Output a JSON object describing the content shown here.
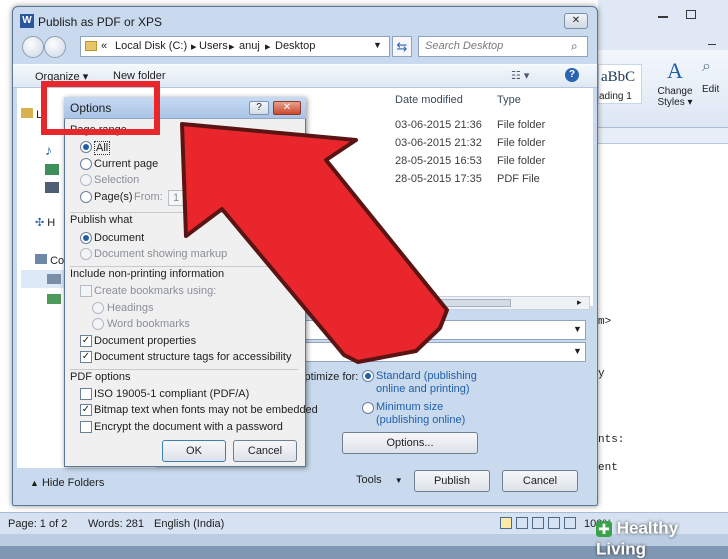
{
  "dialog": {
    "title": "Publish as PDF or XPS",
    "close_glyph": "✕",
    "address": {
      "prefix": "«",
      "parts": [
        "Local Disk (C:)",
        "Users",
        "anuj",
        "Desktop"
      ]
    },
    "search_placeholder": "Search Desktop",
    "toolbar": {
      "organize": "Organize ▾",
      "new_folder": "New folder"
    },
    "nav": [
      {
        "label": "Li",
        "icon": "library-icon"
      },
      {
        "label": "H",
        "icon": "homegroup-icon"
      },
      {
        "label": "Co",
        "icon": "computer-icon"
      }
    ],
    "columns": {
      "date_modified": "Date modified",
      "type": "Type"
    },
    "files": [
      {
        "date": "03-06-2015 21:36",
        "type": "File folder"
      },
      {
        "date": "03-06-2015 21:32",
        "type": "File folder"
      },
      {
        "date": "28-05-2015 16:53",
        "type": "File folder"
      },
      {
        "date": "28-05-2015 17:35",
        "type": "PDF File"
      }
    ],
    "optimize": {
      "label": "Optimize for:",
      "standard": "Standard (publishing online and printing)",
      "standard_l1": "Standard (publishing",
      "standard_l2": "online and printing)",
      "minimum_l1": "Minimum size",
      "minimum_l2": "(publishing online)",
      "selected": "standard"
    },
    "options_button": "Options...",
    "hide_folders": "Hide Folders",
    "tools": "Tools",
    "tools_arrow": "▼",
    "publish": "Publish",
    "cancel": "Cancel"
  },
  "options_dialog": {
    "title": "Options",
    "help": "?",
    "close": "✕",
    "page_range": {
      "header": "Page range",
      "all": "All",
      "current_page": "Current page",
      "selection": "Selection",
      "pages": "Page(s)",
      "from": "From:",
      "from_value": "1",
      "selected": "all"
    },
    "publish_what": {
      "header": "Publish what",
      "document": "Document",
      "document_markup": "Document showing markup",
      "selected": "document"
    },
    "non_printing": {
      "header": "Include non-printing information",
      "create_bookmarks": "Create bookmarks using:",
      "headings": "Headings",
      "word_bookmarks": "Word bookmarks",
      "document_properties": "Document properties",
      "document_properties_checked": true,
      "structure_tags": "Document structure tags for accessibility",
      "structure_tags_checked": true
    },
    "pdf_options": {
      "header": "PDF options",
      "iso": "ISO 19005-1 compliant (PDF/A)",
      "iso_checked": false,
      "bitmap": "Bitmap text when fonts may not be embedded",
      "bitmap_checked": true,
      "encrypt": "Encrypt the document with a password",
      "encrypt_checked": false
    },
    "ok": "OK",
    "cancel": "Cancel"
  },
  "word": {
    "styles_preview": "aBbC",
    "style_name": "ading 1",
    "change_styles": "Change Styles",
    "change_styles_l1": "Change",
    "change_styles_l2": "Styles ▾",
    "edit": "Edit",
    "doc_fragments": [
      "m>",
      "y",
      "nts:",
      "ent"
    ],
    "status": {
      "page": "Page: 1 of 2",
      "words": "Words: 281",
      "language": "English (India)",
      "zoom": "100%"
    }
  },
  "watermark": "Healthy Living",
  "colors": {
    "accent_red": "#e8262b",
    "dialog_blue": "#c9daee",
    "link_blue": "#1f5fa8"
  }
}
